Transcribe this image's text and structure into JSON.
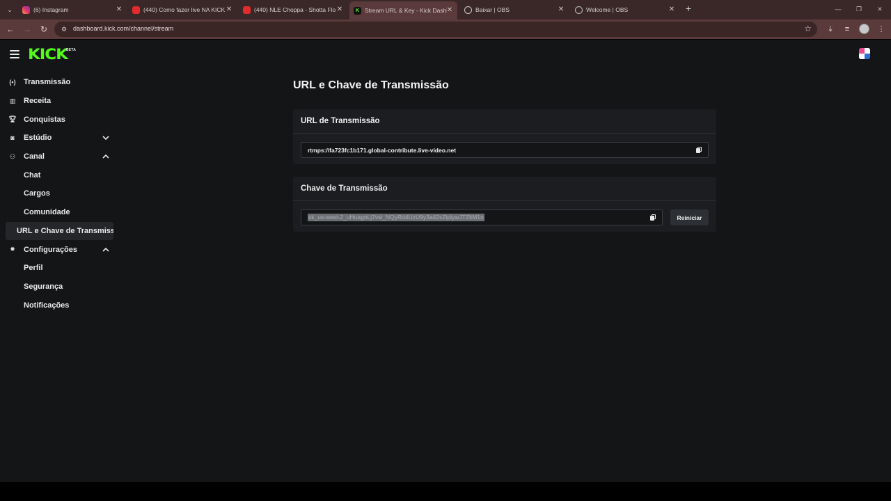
{
  "browser": {
    "tabs": [
      {
        "title": "(6) Instagram",
        "favicon": "instagram-icon"
      },
      {
        "title": "(440) Como fazer live NA KICK",
        "favicon": "youtube-icon"
      },
      {
        "title": "(440) NLE Choppa - Shotta Flo",
        "favicon": "youtube-icon"
      },
      {
        "title": "Stream URL & Key - Kick Dashb",
        "favicon": "kick-icon",
        "active": true
      },
      {
        "title": "Baixar | OBS",
        "favicon": "obs-icon"
      },
      {
        "title": "Welcome | OBS",
        "favicon": "globe-icon"
      }
    ],
    "url": "dashboard.kick.com/channel/stream"
  },
  "header": {
    "logo": "KICK",
    "logo_badge": "BETA"
  },
  "sidebar": {
    "items": [
      {
        "label": "Transmissão",
        "icon": "broadcast-icon"
      },
      {
        "label": "Receita",
        "icon": "chart-icon"
      },
      {
        "label": "Conquistas",
        "icon": "trophy-icon"
      },
      {
        "label": "Estúdio",
        "icon": "studio-icon",
        "expanded": false
      },
      {
        "label": "Canal",
        "icon": "users-icon",
        "expanded": true
      },
      {
        "label": "Chat"
      },
      {
        "label": "Cargos"
      },
      {
        "label": "Comunidade"
      },
      {
        "label": "URL e Chave de Transmissão",
        "active": true
      },
      {
        "label": "Configurações",
        "icon": "gear-icon",
        "expanded": true
      },
      {
        "label": "Perfil"
      },
      {
        "label": "Segurança"
      },
      {
        "label": "Notificações"
      }
    ]
  },
  "main": {
    "title": "URL e Chave de Transmissão",
    "url_card": {
      "heading": "URL de Transmissão",
      "value": "rtmps://fa723fc1b171.global-contribute.live-video.net"
    },
    "key_card": {
      "heading": "Chave de Transmissão",
      "value": "sk_us-west-2_uHuagnLj7vsl_NQyRd4UzU9y3a42sZiplywJTZltM1n",
      "reset_label": "Reiniciar"
    }
  },
  "colors": {
    "brand_green": "#53fc18",
    "page_bg": "#141517",
    "card_bg": "#1b1d20",
    "browser_frame": "#5a3a3a"
  }
}
